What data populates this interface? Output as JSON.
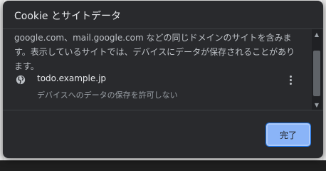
{
  "dialog": {
    "title": "Cookie とサイトデータ",
    "description": "google.com、mail.google.com などの同じドメインのサイトを含みます。表示しているサイトでは、デバイスにデータが保存されることがあります。",
    "sites": [
      {
        "name": "todo.example.jp",
        "status": "デバイスへのデータの保存を許可しない",
        "icon": "globe-icon",
        "menu_icon": "more-vert-icon"
      }
    ],
    "done_label": "完了"
  },
  "colors": {
    "dialog_bg": "#292a2d",
    "accent": "#8ab4f8",
    "text_primary": "#e8eaed",
    "text_secondary": "#bdc1c6"
  }
}
